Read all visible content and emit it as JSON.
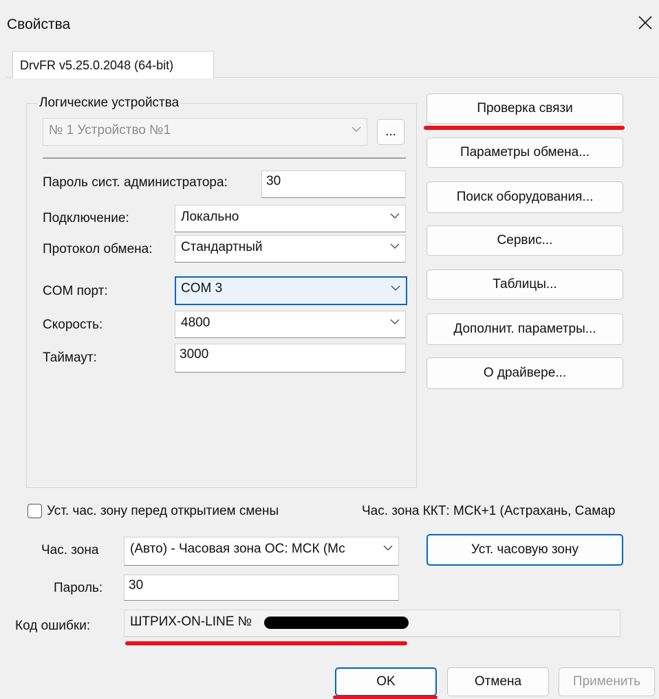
{
  "window": {
    "title": "Свойства"
  },
  "tab": {
    "label": "DrvFR v5.25.0.2048 (64-bit)"
  },
  "devices": {
    "group_label": "Логические устройства",
    "selected": "№ 1 Устройство №1",
    "browse_label": "..."
  },
  "form": {
    "admin_password_label": "Пароль сист. администратора:",
    "admin_password_value": "30",
    "connection_label": "Подключение:",
    "connection_value": "Локально",
    "protocol_label": "Протокол обмена:",
    "protocol_value": "Стандартный",
    "com_port_label": "COM порт:",
    "com_port_value": "COM 3",
    "speed_label": "Скорость:",
    "speed_value": "4800",
    "timeout_label": "Таймаут:",
    "timeout_value": "3000"
  },
  "side_buttons": {
    "check_connection": "Проверка связи",
    "exchange_params": "Параметры обмена...",
    "find_equipment": "Поиск оборудования...",
    "service": "Сервис...",
    "tables": "Таблицы...",
    "extra_params": "Дополнит. параметры...",
    "about": "О драйвере..."
  },
  "timezone": {
    "checkbox_label": "Уст. час. зону перед открытием смены",
    "checkbox_checked": false,
    "kkt_zone_text": "Час. зона ККТ: МСК+1 (Астрахань, Самар",
    "zone_label": "Час. зона",
    "zone_value": "(Авто) - Часовая зона ОС: МСК (Мс",
    "set_zone_button": "Уст. часовую зону",
    "password_label": "Пароль:",
    "password_value": "30"
  },
  "error": {
    "label": "Код ошибки:",
    "value": "ШТРИХ-ON-LINE №"
  },
  "footer": {
    "ok": "OK",
    "cancel": "Отмена",
    "apply": "Применить"
  },
  "colors": {
    "accent": "#0067c0",
    "highlight_underline": "#e8141c",
    "window_bg": "#f0f0f0"
  },
  "icons": [
    "close-icon",
    "chevron-down-icon",
    "checkbox"
  ]
}
